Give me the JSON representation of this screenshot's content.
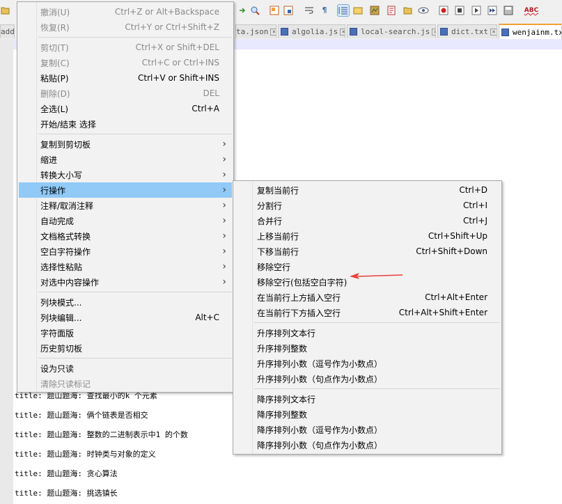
{
  "tabs": [
    {
      "label": "addit",
      "active": false
    },
    {
      "label": "ta.json",
      "active": false
    },
    {
      "label": "algolia.js",
      "active": false
    },
    {
      "label": "local-search.js",
      "active": false
    },
    {
      "label": "dict.txt",
      "active": false
    },
    {
      "label": "wenjainm.txt",
      "active": true
    }
  ],
  "editor_lines": [
    "title: 题山题海: 查找最小的k 个元素",
    "title: 题山题海: 俩个链表是否相交",
    "title: 题山题海: 整数的二进制表示中1 的个数",
    "title: 题山题海: 时钟类与对象的定义",
    "title: 题山题海: 贪心算法",
    "title: 题山题海: 挑选镇长"
  ],
  "toolbar": {
    "spell_check_label": "ABC"
  },
  "context_menu": {
    "items": [
      {
        "label": "撤消(U)",
        "shortcut": "Ctrl+Z or Alt+Backspace",
        "disabled": true
      },
      {
        "label": "恢复(R)",
        "shortcut": "Ctrl+Y or Ctrl+Shift+Z",
        "disabled": true
      },
      {
        "label": "剪切(T)",
        "shortcut": "Ctrl+X or Shift+DEL",
        "disabled": true
      },
      {
        "label": "复制(C)",
        "shortcut": "Ctrl+C or Ctrl+INS",
        "disabled": true
      },
      {
        "label": "粘贴(P)",
        "shortcut": "Ctrl+V or Shift+INS",
        "disabled": false
      },
      {
        "label": "删除(D)",
        "shortcut": "DEL",
        "disabled": true
      },
      {
        "label": "全选(L)",
        "shortcut": "Ctrl+A",
        "disabled": false
      },
      {
        "label": "开始/结束 选择",
        "shortcut": "",
        "disabled": false
      },
      {
        "label": "复制到剪切板",
        "submenu": true
      },
      {
        "label": "缩进",
        "submenu": true
      },
      {
        "label": "转换大小写",
        "submenu": true
      },
      {
        "label": "行操作",
        "submenu": true,
        "highlighted": true
      },
      {
        "label": "注释/取消注释",
        "submenu": true
      },
      {
        "label": "自动完成",
        "submenu": true
      },
      {
        "label": "文档格式转换",
        "submenu": true
      },
      {
        "label": "空白字符操作",
        "submenu": true
      },
      {
        "label": "选择性粘贴",
        "submenu": true
      },
      {
        "label": "对选中内容操作",
        "submenu": true
      },
      {
        "label": "列块模式...",
        "shortcut": ""
      },
      {
        "label": "列块编辑...",
        "shortcut": "Alt+C"
      },
      {
        "label": "字符面版",
        "shortcut": ""
      },
      {
        "label": "历史剪切板",
        "shortcut": ""
      },
      {
        "label": "设为只读",
        "shortcut": ""
      },
      {
        "label": "清除只读标记",
        "shortcut": "",
        "disabled": true
      }
    ]
  },
  "line_ops_submenu": {
    "items": [
      {
        "label": "复制当前行",
        "shortcut": "Ctrl+D"
      },
      {
        "label": "分割行",
        "shortcut": "Ctrl+I"
      },
      {
        "label": "合并行",
        "shortcut": "Ctrl+J"
      },
      {
        "label": "上移当前行",
        "shortcut": "Ctrl+Shift+Up"
      },
      {
        "label": "下移当前行",
        "shortcut": "Ctrl+Shift+Down"
      },
      {
        "label": "移除空行",
        "shortcut": ""
      },
      {
        "label": "移除空行(包括空白字符)",
        "shortcut": ""
      },
      {
        "label": "在当前行上方插入空行",
        "shortcut": "Ctrl+Alt+Enter"
      },
      {
        "label": "在当前行下方插入空行",
        "shortcut": "Ctrl+Alt+Shift+Enter"
      },
      {
        "label": "升序排列文本行",
        "shortcut": ""
      },
      {
        "label": "升序排列整数",
        "shortcut": ""
      },
      {
        "label": "升序排列小数（逗号作为小数点）",
        "shortcut": ""
      },
      {
        "label": "升序排列小数（句点作为小数点）",
        "shortcut": ""
      },
      {
        "label": "降序排列文本行",
        "shortcut": ""
      },
      {
        "label": "降序排列整数",
        "shortcut": ""
      },
      {
        "label": "降序排列小数（逗号作为小数点）",
        "shortcut": ""
      },
      {
        "label": "降序排列小数（句点作为小数点）",
        "shortcut": ""
      }
    ]
  },
  "colors": {
    "highlight": "#91c9f7",
    "annotation_arrow": "#e8403a"
  }
}
